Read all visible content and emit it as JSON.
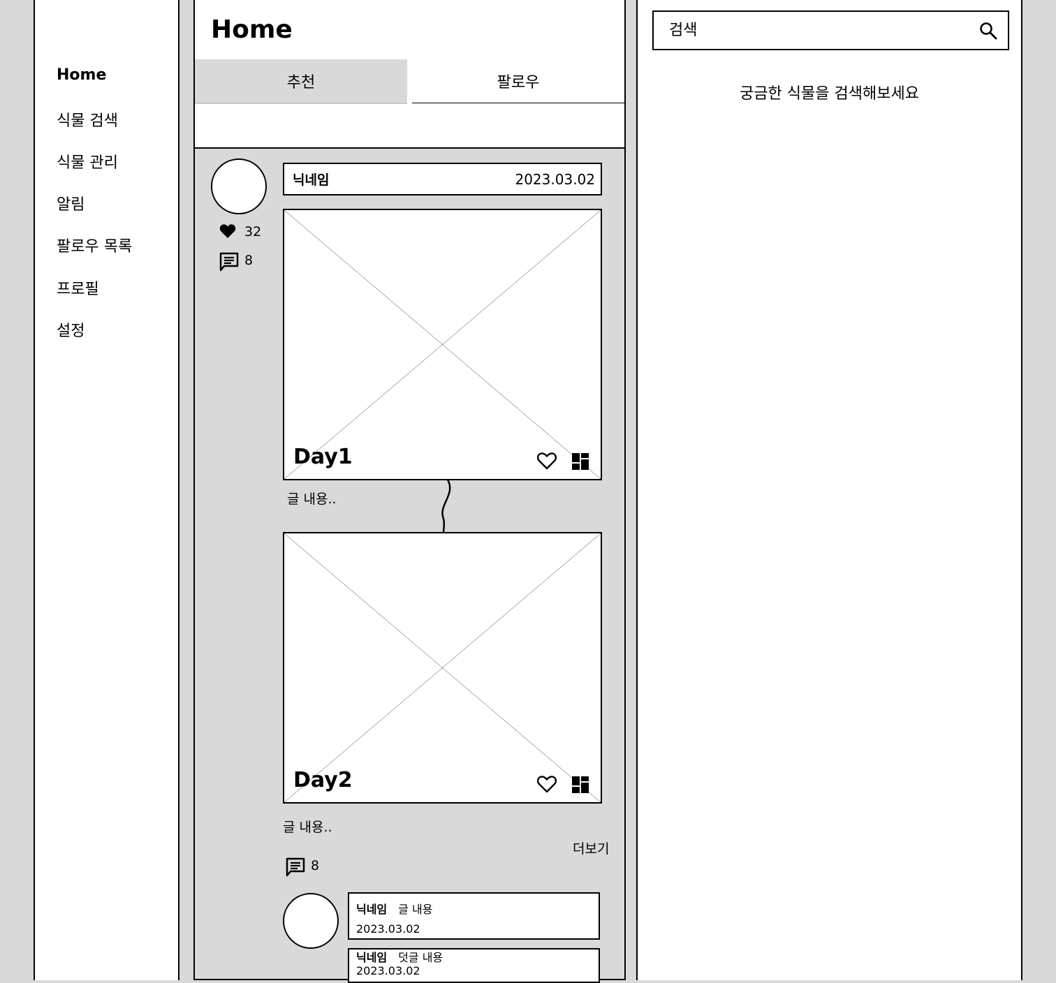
{
  "nav": {
    "items": [
      {
        "label": "Home"
      },
      {
        "label": "식물 검색"
      },
      {
        "label": "식물 관리"
      },
      {
        "label": "알림"
      },
      {
        "label": "팔로우 목록"
      },
      {
        "label": "프로필"
      },
      {
        "label": "설정"
      }
    ]
  },
  "main": {
    "title": "Home",
    "tabs": [
      {
        "label": "추천"
      },
      {
        "label": "팔로우"
      }
    ],
    "post": {
      "nickname": "닉네임",
      "date": "2023.03.02",
      "likes": "32",
      "comments": "8",
      "entries": [
        {
          "day": "Day1",
          "content": "글 내용.."
        },
        {
          "day": "Day2",
          "content": "글 내용.."
        }
      ],
      "more_label": "더보기",
      "comment_count": "8",
      "comment": {
        "nickname": "닉네임",
        "text": "글 내용",
        "date": "2023.03.02"
      },
      "reply": {
        "nickname": "닉네임",
        "text": "덧글 내용",
        "date": "2023.03.02"
      }
    }
  },
  "search": {
    "placeholder": "검색",
    "hint": "궁금한 식물을 검색해보세요"
  },
  "icons": {
    "search": "search-icon",
    "heart_filled": "heart-filled-icon",
    "heart_outline": "heart-outline-icon",
    "comment": "comment-icon",
    "grid": "dashboard-icon"
  }
}
